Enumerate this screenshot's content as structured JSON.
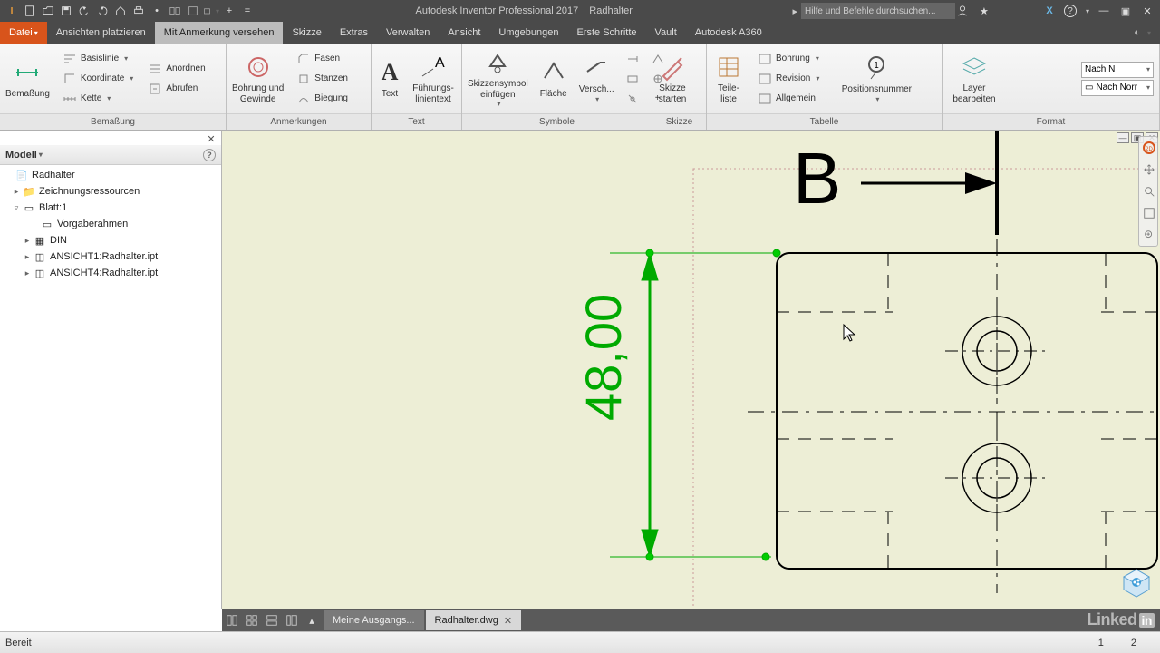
{
  "title": {
    "app": "Autodesk Inventor Professional 2017",
    "doc": "Radhalter",
    "search_placeholder": "Hilfe und Befehle durchsuchen..."
  },
  "tabs": {
    "file": "Datei",
    "t1": "Ansichten platzieren",
    "t2": "Mit Anmerkung versehen",
    "t3": "Skizze",
    "t4": "Extras",
    "t5": "Verwalten",
    "t6": "Ansicht",
    "t7": "Umgebungen",
    "t8": "Erste Schritte",
    "t9": "Vault",
    "t10": "Autodesk A360"
  },
  "ribbon": {
    "p1": {
      "title": "Bemaßung",
      "big": "Bemaßung",
      "b1": "Basislinie",
      "b2": "Koordinate",
      "b3": "Kette",
      "b4": "Anordnen",
      "b5": "Abrufen"
    },
    "p2": {
      "title": "Anmerkungen",
      "big": "Bohrung und\nGewinde",
      "b1": "Fasen",
      "b2": "Stanzen",
      "b3": "Biegung"
    },
    "p3": {
      "title": "Text",
      "big1": "Text",
      "big2": "Führungs-\nlinientext"
    },
    "p4": {
      "title": "Symbole",
      "big1": "Skizzensymbol\neinfügen",
      "big2": "Fläche",
      "big3": "Versch..."
    },
    "p5": {
      "title": "Skizze",
      "big": "Skizze\nstarten"
    },
    "p6": {
      "title": "Tabelle",
      "big1": "Teile-\nliste",
      "big2": "Positionsnummer",
      "b1": "Bohrung",
      "b2": "Revision",
      "b3": "Allgemein"
    },
    "p7": {
      "title": "Format",
      "big": "Layer\nbearbeiten",
      "c1": "Nach N",
      "c2": "Nach Norr"
    }
  },
  "browser": {
    "title": "Modell",
    "root": "Radhalter",
    "n1": "Zeichnungsressourcen",
    "n2": "Blatt:1",
    "n3": "Vorgaberahmen",
    "n4": "DIN",
    "n5": "ANSICHT1:Radhalter.ipt",
    "n6": "ANSICHT4:Radhalter.ipt"
  },
  "canvas": {
    "section_label": "B",
    "dim_value": "48,00"
  },
  "doctabs": {
    "t1": "Meine Ausgangs...",
    "t2": "Radhalter.dwg"
  },
  "status": {
    "msg": "Bereit",
    "n1": "1",
    "n2": "2"
  }
}
